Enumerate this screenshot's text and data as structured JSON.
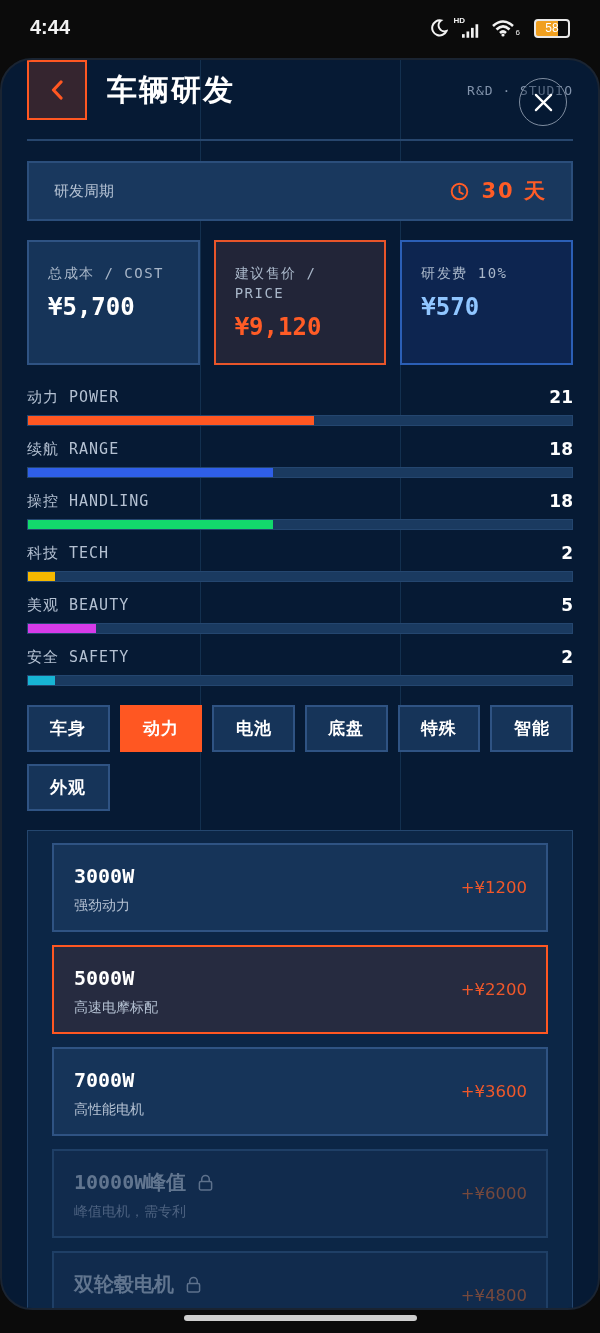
{
  "status_bar": {
    "time": "4:44",
    "network_label": "HD",
    "wifi_label": "6",
    "battery": "58"
  },
  "header": {
    "title": "车辆研发",
    "subtitle": "R&D · STUDIO"
  },
  "dev_cycle": {
    "label": "研发周期",
    "value": "30 天"
  },
  "cost_cards": [
    {
      "kind": "default",
      "label": "总成本 / COST",
      "value": "¥5,700"
    },
    {
      "kind": "highlight",
      "label": "建议售价 / PRICE",
      "value": "¥9,120"
    },
    {
      "kind": "info",
      "label": "研发费 10%",
      "value": "¥570"
    }
  ],
  "stats": [
    {
      "label": "动力 POWER",
      "value": "21",
      "level": 0.525,
      "color": "#ff5722"
    },
    {
      "label": "续航 RANGE",
      "value": "18",
      "level": 0.45,
      "color": "#2f5fe8"
    },
    {
      "label": "操控 HANDLING",
      "value": "18",
      "level": 0.45,
      "color": "#12d86c"
    },
    {
      "label": "科技 TECH",
      "value": "2",
      "level": 0.05,
      "color": "#f5b800"
    },
    {
      "label": "美观 BEAUTY",
      "value": "5",
      "level": 0.125,
      "color": "#d63be8"
    },
    {
      "label": "安全 SAFETY",
      "value": "2",
      "level": 0.05,
      "color": "#17b4d4"
    }
  ],
  "tabs": [
    {
      "label": "车身",
      "selected": false
    },
    {
      "label": "动力",
      "selected": true
    },
    {
      "label": "电池",
      "selected": false
    },
    {
      "label": "底盘",
      "selected": false
    },
    {
      "label": "特殊",
      "selected": false
    },
    {
      "label": "智能",
      "selected": false
    },
    {
      "label": "外观",
      "selected": false
    }
  ],
  "options": [
    {
      "name": "3000W",
      "description": "强劲动力",
      "price": "+¥1200",
      "selected": false,
      "locked": false
    },
    {
      "name": "5000W",
      "description": "高速电摩标配",
      "price": "+¥2200",
      "selected": true,
      "locked": false
    },
    {
      "name": "7000W",
      "description": "高性能电机",
      "price": "+¥3600",
      "selected": false,
      "locked": false
    },
    {
      "name": "10000W峰值",
      "description": "峰值电机，需专利",
      "price": "+¥6000",
      "selected": false,
      "locked": true
    },
    {
      "name": "双轮毂电机",
      "price": "+¥4800",
      "selected": false,
      "locked": true
    }
  ]
}
